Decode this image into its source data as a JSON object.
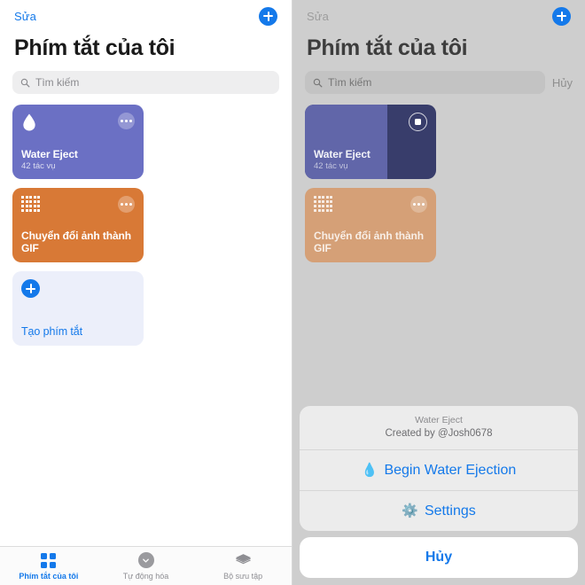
{
  "colors": {
    "accent_blue": "#1479ea",
    "card_purple": "#6b70c4",
    "card_orange": "#d87936",
    "card_new": "#eceffa",
    "card_running_dark": "#383d6b",
    "card_running_fill": "#6166a9",
    "overlay_gray": "#cecece"
  },
  "left": {
    "navbar": {
      "edit_label": "Sửa",
      "add_icon": "plus-icon"
    },
    "title": "Phím tắt của tôi",
    "search": {
      "placeholder": "Tìm kiếm",
      "icon": "search-icon"
    },
    "cards": [
      {
        "name": "Water Eject",
        "subtitle": "42 tác vụ",
        "icon": "water-drop-icon",
        "menu_icon": "ellipsis-icon"
      },
      {
        "name": "Chuyển đổi ảnh thành GIF",
        "subtitle": "",
        "icon": "dot-grid-icon",
        "menu_icon": "ellipsis-icon"
      },
      {
        "name": "Tạo phím tắt",
        "subtitle": "",
        "icon": "plus-circle-icon",
        "menu_icon": ""
      }
    ],
    "tabs": [
      {
        "label": "Phím tắt của tôi",
        "icon": "grid-squares-icon",
        "active": true
      },
      {
        "label": "Tự động hóa",
        "icon": "chevron-down-circle-icon",
        "active": false
      },
      {
        "label": "Bộ sưu tập",
        "icon": "layers-icon",
        "active": false
      }
    ]
  },
  "right": {
    "navbar": {
      "edit_label": "Sửa",
      "add_icon": "plus-icon"
    },
    "title": "Phím tắt của tôi",
    "search": {
      "placeholder": "Tìm kiếm",
      "icon": "search-icon",
      "cancel_label": "Hủy"
    },
    "cards": [
      {
        "name": "Water Eject",
        "subtitle": "42 tác vụ",
        "state": "running",
        "progress_percent": 63,
        "action_icon": "stop-icon"
      },
      {
        "name": "Chuyển đổi ảnh thành GIF",
        "subtitle": "",
        "icon": "dot-grid-icon",
        "menu_icon": "ellipsis-icon"
      }
    ],
    "action_sheet": {
      "title": "Water Eject",
      "subtitle": "Created by @Josh0678",
      "options": [
        {
          "label": "Begin Water Ejection",
          "emoji": "💧",
          "icon": "water-drop-emoji"
        },
        {
          "label": "Settings",
          "emoji": "⚙️",
          "icon": "gear-emoji"
        }
      ],
      "cancel_label": "Hủy"
    }
  }
}
